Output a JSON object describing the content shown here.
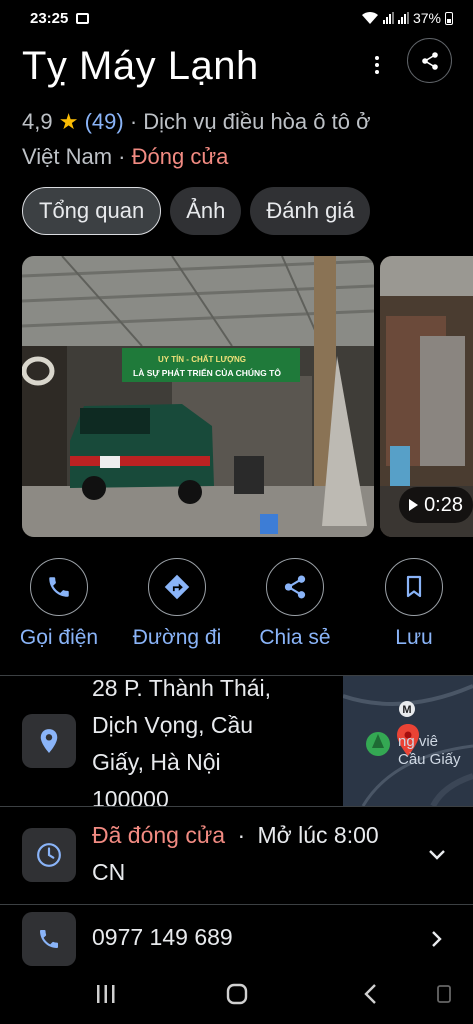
{
  "status_bar": {
    "time": "23:25",
    "battery": "37%"
  },
  "place": {
    "name": "Tỵ Máy Lạnh",
    "rating": "4,9",
    "review_count": "(49)",
    "category": "· Dịch vụ điều hòa ô tô ở Việt Nam ·",
    "status": "Đóng cửa"
  },
  "tabs": [
    {
      "label": "Tổng quan",
      "active": true
    },
    {
      "label": "Ảnh",
      "active": false
    },
    {
      "label": "Đánh giá",
      "active": false
    }
  ],
  "photos": {
    "video_duration": "0:28",
    "shop_sign_line1": "UY TÍN - CHẤT LƯỢNG",
    "shop_sign_line2": "LÀ SỰ PHÁT TRIỂN CỦA CHÚNG TÔ"
  },
  "actions": [
    {
      "label": "Gọi điện",
      "icon": "phone-icon"
    },
    {
      "label": "Đường đi",
      "icon": "directions-icon"
    },
    {
      "label": "Chia sẻ",
      "icon": "share-icon"
    },
    {
      "label": "Lưu",
      "icon": "bookmark-icon"
    }
  ],
  "address": {
    "line1": "28 P. Thành Thái,",
    "line2": "Dịch Vọng, Cầu",
    "line3": "Giấy, Hà Nội",
    "line4": "100000",
    "map_label_1": "ng viê",
    "map_label_2": "Cầu Giấy",
    "map_marker": "M"
  },
  "hours": {
    "status": "Đã đóng cửa",
    "separator": "·",
    "opens": "Mở lúc 8:00",
    "day": "CN"
  },
  "phone": {
    "number": "0977 149 689"
  },
  "colors": {
    "accent_blue": "#8ab4f8",
    "closed_red": "#f28b82",
    "star_yellow": "#fbbc04"
  }
}
